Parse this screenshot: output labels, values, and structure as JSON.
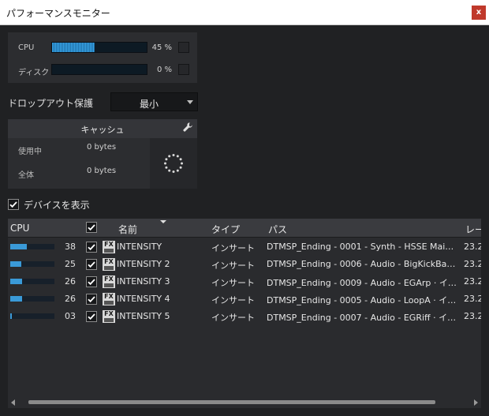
{
  "window": {
    "title": "パフォーマンスモニター",
    "close_label": "x"
  },
  "meters": [
    {
      "label": "CPU",
      "percent_text": "45 %",
      "level": 0.45
    },
    {
      "label": "ディスク",
      "percent_text": "0 %",
      "level": 0.0
    }
  ],
  "dropout": {
    "label": "ドロップアウト保護",
    "value": "最小"
  },
  "cache": {
    "title": "キャッシュ",
    "used_label": "使用中",
    "used_value": "0 bytes",
    "total_label": "全体",
    "total_value": "0 bytes"
  },
  "show_devices": {
    "label": "デバイスを表示",
    "checked": true
  },
  "table": {
    "headers": {
      "cpu": "CPU",
      "name": "名前",
      "type": "タイプ",
      "path": "パス",
      "latency": "レー"
    },
    "rows": [
      {
        "cpu": "38",
        "cpu_level": 0.38,
        "name": "INTENSITY",
        "type": "インサート",
        "path": "DTMSP_Ending - 0001 - Synth - HSSE Mai…",
        "latency": "23.2"
      },
      {
        "cpu": "25",
        "cpu_level": 0.25,
        "name": "INTENSITY 2",
        "type": "インサート",
        "path": "DTMSP_Ending - 0006 - Audio - BigKickBa…",
        "latency": "23.2"
      },
      {
        "cpu": "26",
        "cpu_level": 0.26,
        "name": "INTENSITY 3",
        "type": "インサート",
        "path": "DTMSP_Ending - 0009 - Audio - EGArp · イ…",
        "latency": "23.2"
      },
      {
        "cpu": "26",
        "cpu_level": 0.26,
        "name": "INTENSITY 4",
        "type": "インサート",
        "path": "DTMSP_Ending - 0005 - Audio - LoopA · イ…",
        "latency": "23.2"
      },
      {
        "cpu": "03",
        "cpu_level": 0.03,
        "name": "INTENSITY 5",
        "type": "インサート",
        "path": "DTMSP_Ending - 0007 - Audio - EGRiff · イ…",
        "latency": "23.2"
      }
    ]
  },
  "icons": {
    "fx": "FX",
    "wrench": "wrench-icon",
    "spinner": "loading-spinner-icon",
    "check": "checkmark-icon"
  },
  "colors": {
    "meter_fill": "#3aa6e8",
    "cpu_fill": "#3a9ad8",
    "background": "#202123"
  }
}
